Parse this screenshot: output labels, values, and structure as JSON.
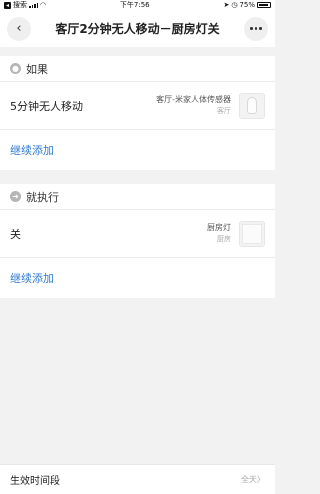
{
  "status_bar": {
    "back_app": "搜索",
    "time": "下午7:56",
    "battery": "75%"
  },
  "nav": {
    "title": "客厅2分钟无人移动－厨房灯关",
    "back_glyph": "‹"
  },
  "if_section": {
    "label": "如果",
    "icon": "dot-icon",
    "condition": {
      "title": "5分钟无人移动",
      "device": "客厅-米家人体传感器",
      "room": "客厅"
    },
    "add_label": "继续添加"
  },
  "then_section": {
    "label": "就执行",
    "icon": "arrow-icon",
    "action": {
      "title": "关",
      "device": "厨房灯",
      "room": "厨房"
    },
    "add_label": "继续添加"
  },
  "footer": {
    "label": "生效时间段",
    "value": "全天〉"
  },
  "colors": {
    "link": "#2f7bd3",
    "background": "#f2f2f2"
  }
}
